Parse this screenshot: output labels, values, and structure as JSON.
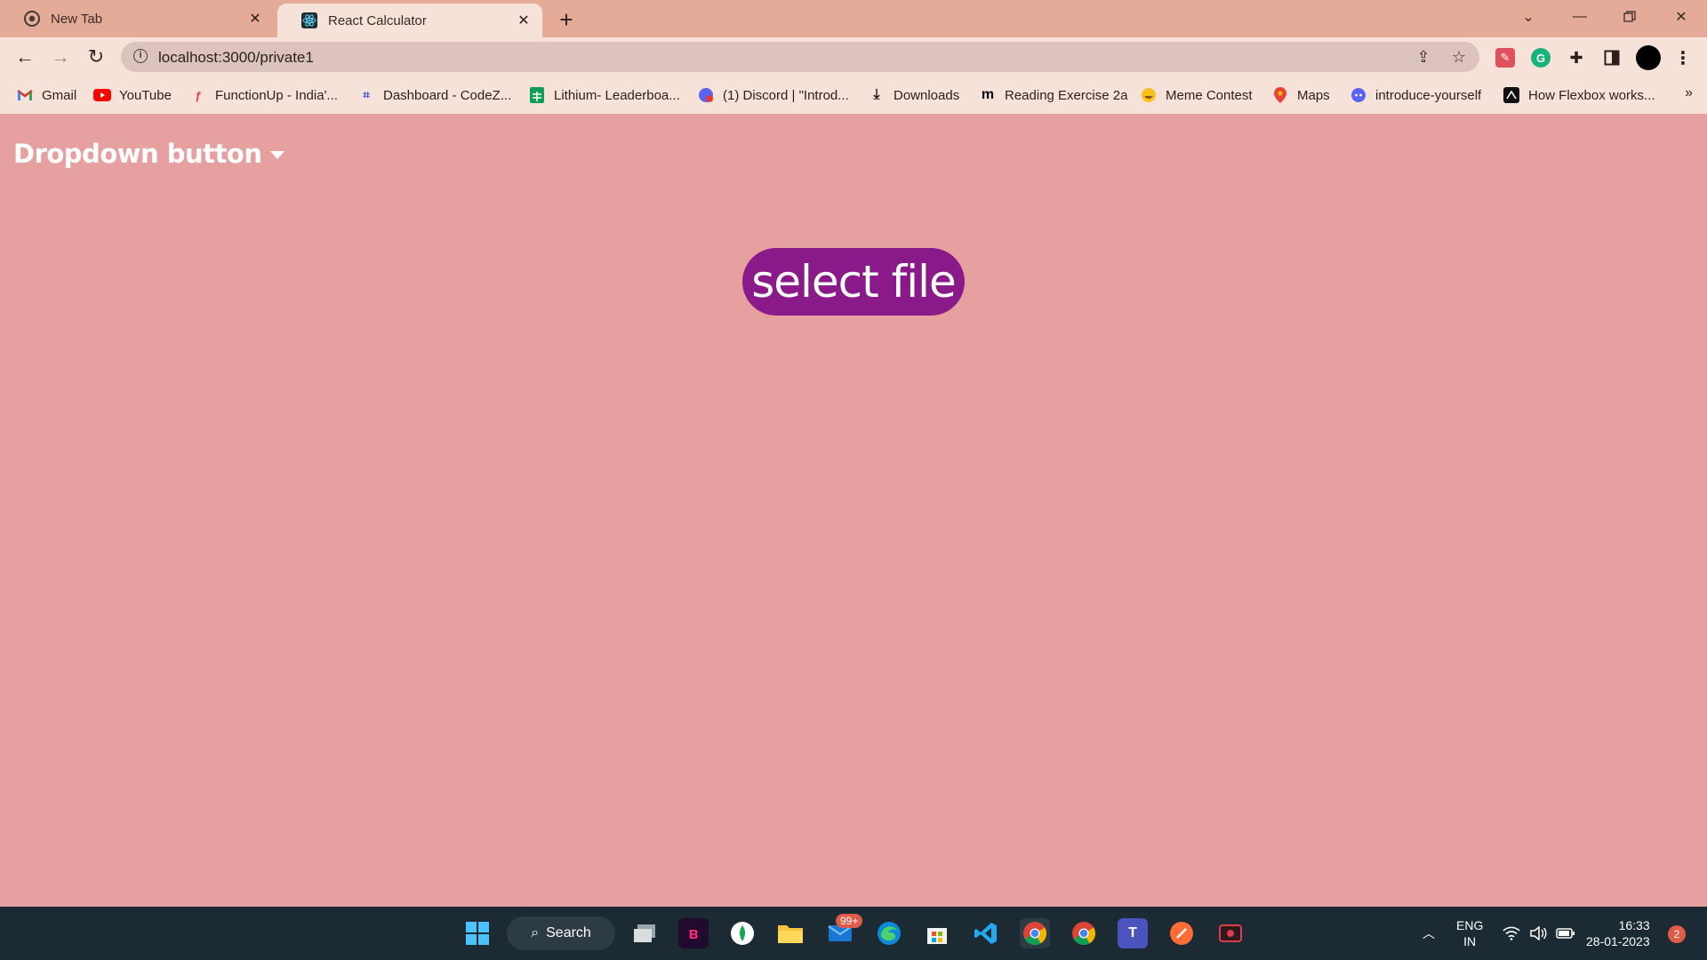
{
  "tabs": [
    {
      "title": "New Tab",
      "icon": "chrome-icon",
      "active": false
    },
    {
      "title": "React Calculator",
      "icon": "react-icon",
      "active": true
    }
  ],
  "address_bar": {
    "url": "localhost:3000/private1"
  },
  "bookmarks": [
    {
      "label": "Gmail",
      "icon": "gmail-icon"
    },
    {
      "label": "YouTube",
      "icon": "youtube-icon"
    },
    {
      "label": "FunctionUp - India'...",
      "icon": "functionup-icon"
    },
    {
      "label": "Dashboard - CodeZ...",
      "icon": "codezinger-icon"
    },
    {
      "label": "Lithium- Leaderboa...",
      "icon": "sheets-icon"
    },
    {
      "label": "(1) Discord | \"Introd...",
      "icon": "discord-icon"
    },
    {
      "label": "Downloads",
      "icon": "download-icon"
    },
    {
      "label": "Reading Exercise 2a",
      "icon": "medium-icon"
    },
    {
      "label": "Meme Contest",
      "icon": "emoji-icon"
    },
    {
      "label": "Maps",
      "icon": "maps-icon"
    },
    {
      "label": "introduce-yourself",
      "icon": "discord-icon"
    },
    {
      "label": "How Flexbox works...",
      "icon": "flexbox-icon"
    }
  ],
  "page": {
    "dropdown_label": "Dropdown button",
    "select_file_label": "select file"
  },
  "taskbar": {
    "search_label": "Search",
    "mail_badge": "99+",
    "lang_line1": "ENG",
    "lang_line2": "IN",
    "time": "16:33",
    "date": "28-01-2023",
    "notification_count": "2"
  },
  "colors": {
    "page_background": "#e6a0a0",
    "select_file_button": "#8a1a8a",
    "tabstrip": "#e3ab98",
    "toolbar": "#f7e2da",
    "taskbar": "#1b2a33"
  }
}
